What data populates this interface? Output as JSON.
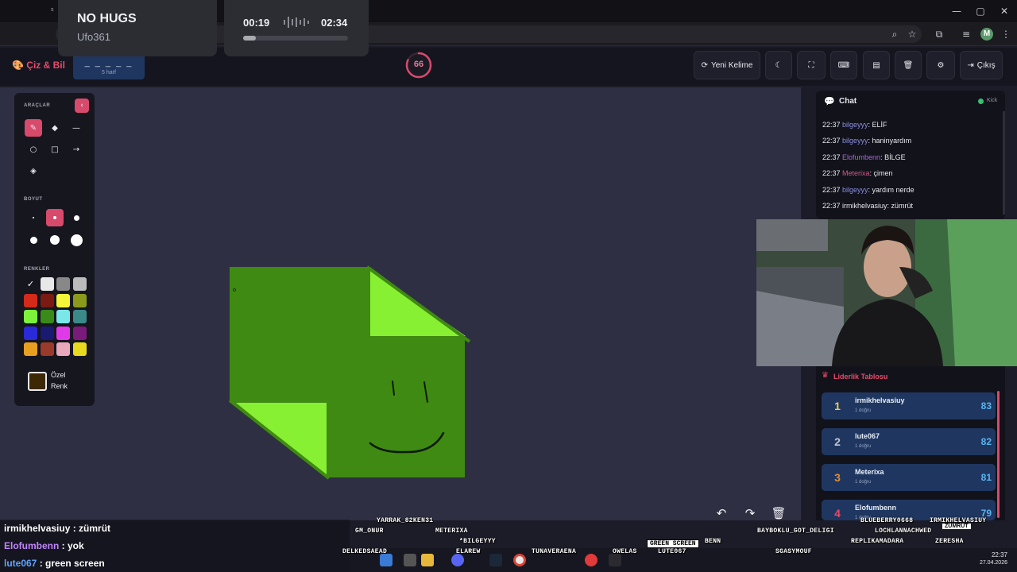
{
  "browser": {
    "tab_hint": "s",
    "window_controls": [
      "—",
      "▢",
      "✕"
    ],
    "toolbar_icons": [
      "⌕",
      "☆",
      "⧉",
      "≡",
      "⋮"
    ],
    "profile_initial": "M"
  },
  "music": {
    "title": "NO HUGS",
    "artist": "Ufo361",
    "current_time": "00:19",
    "total_time": "02:34",
    "progress": 0.12
  },
  "header": {
    "logo": "Çiz & Bil",
    "word_dashes": "_ _ _ _ _",
    "word_hint": "5 harf",
    "timer": "66",
    "timer_fraction": 0.82,
    "new_word_label": "Yeni Kelime",
    "logout_label": "Çıkış"
  },
  "tools": {
    "section_tools": "ARAÇLAR",
    "section_size": "BOYUT",
    "section_colors": "RENKLER",
    "custom_line1": "Özel",
    "custom_line2": "Renk",
    "colors": [
      "#ffffff",
      "#e8e8e8",
      "#888888",
      "#bbbbbb",
      "#d42a1a",
      "#7a1a12",
      "#f5f53a",
      "#8c9a1c",
      "#7cf23a",
      "#3a8a1a",
      "#7ae8e8",
      "#3a8a8a",
      "#2a2ad8",
      "#1a1a70",
      "#e03ae8",
      "#7a1a7a",
      "#e8a020",
      "#9a3a2a",
      "#e8aabb",
      "#e8d820"
    ]
  },
  "chat": {
    "title": "Chat",
    "kick_label": "Kick",
    "messages": [
      {
        "time": "22:37",
        "user": "bilgeyyy",
        "user_color": "#8a8fe0",
        "text": ": ELİF"
      },
      {
        "time": "22:37",
        "user": "bilgeyyy",
        "user_color": "#8a8fe0",
        "text": ": haninyardım"
      },
      {
        "time": "22:37",
        "user": "Elofumbenn",
        "user_color": "#a46ad8",
        "text": ": BİLGE"
      },
      {
        "time": "22:37",
        "user": "Meterixa",
        "user_color": "#d05a8a",
        "text": ": çimen"
      },
      {
        "time": "22:37",
        "user": "bilgeyyy",
        "user_color": "#8a8fe0",
        "text": ": yardım nerde"
      },
      {
        "time": "22:37",
        "user": "irmikhelvasiuy",
        "user_color": "#e8e8ef",
        "text": ": zümrüt"
      }
    ]
  },
  "leaderboard": {
    "title": "Liderlik Tablosu",
    "rows": [
      {
        "rank": "1",
        "rank_color": "#f2c94c",
        "name": "irmikhelvasiuy",
        "sub": "1 doğru",
        "score": "83"
      },
      {
        "rank": "2",
        "rank_color": "#c0c6d4",
        "name": "lute067",
        "sub": "1 doğru",
        "score": "82"
      },
      {
        "rank": "3",
        "rank_color": "#e08a3a",
        "name": "Meterixa",
        "sub": "1 doğru",
        "score": "81"
      },
      {
        "rank": "4",
        "rank_color": "#e84a6b",
        "name": "Elofumbenn",
        "sub": "1 doğru",
        "score": "79"
      }
    ]
  },
  "stream_chat": [
    {
      "user": "irmikhelvasiuy",
      "user_color": "#ffffff",
      "text": " : zümrüt"
    },
    {
      "user": "Elofumbenn",
      "user_color": "#c084fc",
      "text": " : yok"
    },
    {
      "user": "lute067",
      "user_color": "#60a5fa",
      "text": " : green screen"
    }
  ],
  "overlay_names": {
    "yarrak": "YARRAK_82KEN31",
    "gm": "GM_ONUR",
    "meterixa": "METERIXA",
    "bilgeyyy": "*BILGEYYY",
    "delkeds": "DELKEDSAEAD",
    "elarew": "ELAREW",
    "tunavera": "TUNAVERAENA",
    "owelas": "OWELAS",
    "lute": "LUTE067",
    "benn": "BENN",
    "green_screen": "GREEN SCREEN",
    "baybok": "BAYBOKLU_GOT_DELIGI",
    "blueberry": "BLUEBERRY0668",
    "irmik": "IRMIKHELVASIUY",
    "zumrut": "ZÜMRÜT",
    "lochlan": "LOCHLANNACHWED",
    "sgasy": "SGASYMOUF",
    "replika": "REPLIKAMADARA",
    "zeresha": "ZERESHA"
  },
  "taskbar": {
    "time": "22:37",
    "date": "27.04.2026"
  }
}
